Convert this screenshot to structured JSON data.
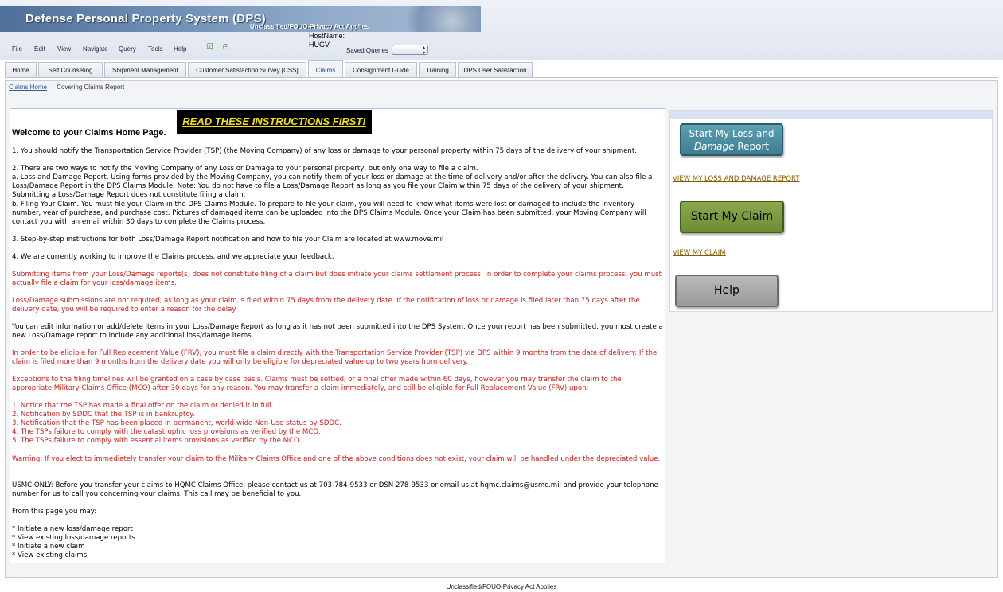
{
  "banner": {
    "title": "Defense Personal Property System (DPS)",
    "classification": "Unclassified/FOUO-Privacy Act Applies"
  },
  "menu": {
    "items": [
      "File",
      "Edit",
      "View",
      "Navigate",
      "Query",
      "Tools",
      "Help"
    ],
    "icons": [
      "checklist-icon",
      "clock-icon"
    ]
  },
  "host": {
    "label": "HostName:",
    "value": "HUGV"
  },
  "saved_queries": {
    "label": "Saved Queries",
    "value": ""
  },
  "tabs": [
    {
      "label": "Home"
    },
    {
      "label": "Self Counseling"
    },
    {
      "label": "Shipment Management"
    },
    {
      "label": "Customer Satisfaction Survey [CSS]"
    },
    {
      "label": "Claims",
      "active": true
    },
    {
      "label": "Consignment Guide"
    },
    {
      "label": "Training"
    },
    {
      "label": "DPS User Satisfaction"
    }
  ],
  "breadcrumb": {
    "link": "Claims Home",
    "current": "Covering Claims Report"
  },
  "instructions_button": "READ THESE INSTRUCTIONS FIRST!",
  "welcome": "Welcome to your Claims Home Page.",
  "paragraphs": [
    "1. You should notify the Transportation Service Provider (TSP) (the Moving Company) of any loss or damage to your personal property within 75 days of the delivery of your shipment.",
    "2. There are two ways to notify the Moving Company of any Loss or Damage to your personal property, but only one way to file a claim.",
    "a. Loss and Damage Report. Using forms provided by the Moving Company, you can notify them of your loss or damage at the time of delivery and/or after the delivery. You can also file a Loss/Damage Report in the DPS Claims Module. Note: You do not have to file a Loss/Damage Report as long as you file your Claim within 75 days of the delivery of your shipment. Submitting a Loss/Damage Report does not constitute filing a claim.",
    "b. Filing Your Claim. You must file your Claim in the DPS Claims Module. To prepare to file your claim, you will need to know what items were lost or damaged to include the inventory number, year of purchase, and purchase cost. Pictures of damaged items can be uploaded into the DPS Claims Module. Once your Claim has been submitted, your Moving Company will contact you with an email within 30 days to complete the Claims process.",
    "3. Step-by-step instructions for both Loss/Damage Report notification and how to file your Claim are located at www.move.mil .",
    "4. We are currently working to improve the Claims process, and we appreciate your feedback.",
    "Submitting items from your Loss/Damage reports(s) does not constitute filing of a claim but does initiate your claims settlement process. In order to complete your claims process, you must actually file a claim for your loss/damage items.",
    "Loss/Damage submissions are not required, as long as your claim is filed within 75 days from the delivery date. If the notification of loss or damage is filed later than 75 days after the delivery date, you will be required to enter a reason for the delay.",
    "You can edit information or add/delete items in your Loss/Damage Report as long as it has not been submitted into the DPS System. Once your report has been submitted, you must create a new Loss/Damage report to include any additional loss/damage items.",
    "In order to be eligible for Full Replacement Value (FRV), you must file a claim directly with the Transportation Service Provider (TSP) via DPS within 9 months from the date of delivery. If the claim is filed more than 9 months from the delivery date you will only be eligible for depreciated value up to two years from delivery.",
    "Exceptions to the filing timelines will be granted on a case by case basis. Claims must be settled, or a final offer made within 60 days, however you may transfer the claim to the appropriate Military Claims Office (MCO) after 30-days for any reason. You may transfer a claim immediately, and still be eligible for Full Replacement Value (FRV) upon:",
    "1. Notice that the TSP has made a final offer on the claim or denied it in full.",
    "2. Notification by SDDC that the TSP is in bankruptcy.",
    "3. Notification that the TSP has been placed in permanent, world-wide Non-Use status by SDDC.",
    "4. The TSPs failure to comply with the catastrophic loss provisions as verified by the MCO.",
    "5. The TSPs failure to comply with essential items provisions as verified by the MCO.",
    "Warning: If you elect to immediately transfer your claim to the Military Claims Office and one of the above conditions does not exist, your claim will be handled under the depreciated value.",
    "USMC ONLY: Before you transfer your claims to HQMC Claims Office, please contact us at 703-784-9533 or DSN 278-9533 or email us at hqmc.claims@usmc.mil and provide your telephone number for us to call you concerning your claims. This call may be beneficial to you.",
    "From this page you may:",
    "* Initiate a new loss/damage report",
    "* View existing loss/damage reports",
    "* Initiate a new claim",
    "* View existing claims"
  ],
  "right": {
    "loss_button_line1": "Start My Loss and",
    "loss_button_line2a": "Damage",
    "loss_button_line2b": " Report",
    "view_loss_link": "VIEW MY LOSS AND DAMAGE REPORT",
    "claim_button": "Start My Claim",
    "view_claim_link": "VIEW MY CLAIM",
    "help_button": "Help"
  },
  "footer": "Unclassified/FOUO-Privacy Act Applies",
  "colors": {
    "warning_red": "#d0201b",
    "link": "#8a5a00",
    "accent_blue": "#0a4aa2"
  }
}
